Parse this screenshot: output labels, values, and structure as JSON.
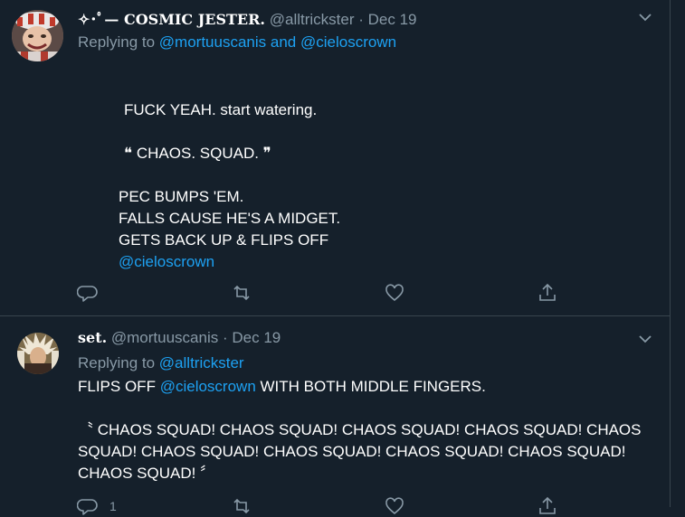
{
  "tweets": [
    {
      "display_name": "✧･ﾟ— COSMIC JESTER.",
      "handle": "@alltrickster",
      "separator": "·",
      "date": "Dec 19",
      "replying_prefix": "Replying to",
      "replying_user1": "@mortuuscanis",
      "replying_and": "and",
      "replying_user2": "@cieloscrown",
      "lines": [
        "FUCK YEAH. start watering.",
        "❝ CHAOS. SQUAD. ❞",
        "PEC BUMPS 'EM.",
        "FALLS CAUSE HE'S A MIDGET.",
        "GETS BACK UP & FLIPS OFF"
      ],
      "mention": "@cieloscrown"
    },
    {
      "display_name": "set.",
      "handle": "@mortuuscanis",
      "separator": "·",
      "date": "Dec 19",
      "replying_prefix": "Replying to",
      "replying_user1": "@alltrickster",
      "text_prefix": "FLIPS OFF",
      "mention": "@cieloscrown",
      "text_suffix": "WITH BOTH MIDDLE FINGERS.",
      "chant": "〝 CHAOS SQUAD! CHAOS SQUAD! CHAOS SQUAD! CHAOS SQUAD! CHAOS SQUAD! CHAOS SQUAD! CHAOS SQUAD! CHAOS SQUAD! CHAOS SQUAD! CHAOS SQUAD! 〞",
      "reply_count": "1"
    }
  ]
}
